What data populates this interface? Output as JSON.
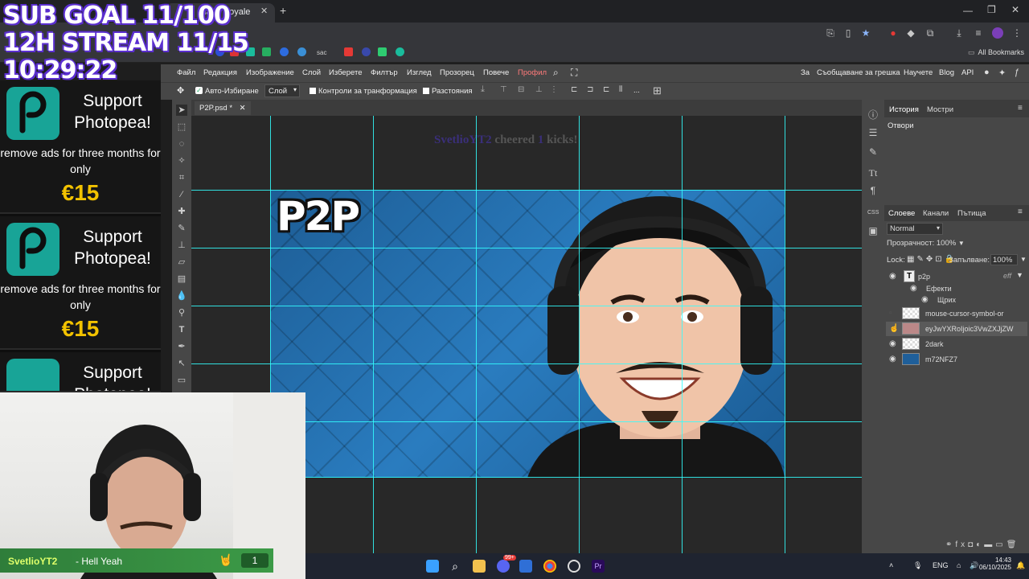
{
  "browser": {
    "tab_title": "Clash Royale",
    "bookmarks_label": "All Bookmarks",
    "bookmark_text": "sac"
  },
  "menu": {
    "items": [
      "Файл",
      "Редакция",
      "Изображение",
      "Слой",
      "Изберете",
      "Филтър",
      "Изглед",
      "Прозорец",
      "Повече",
      "Профил"
    ],
    "right_items": [
      "За",
      "Съобщаване за грешка",
      "Научете",
      "Blog",
      "API"
    ]
  },
  "options": {
    "auto_select_label": "Авто-Избиране",
    "layer_select_value": "Слой",
    "transform_controls_label": "Контроли за транформация",
    "distances_label": "Разстояния",
    "more": "..."
  },
  "document": {
    "tab_label": "P2P.psd *",
    "title_text": "P2P",
    "cheer_user": "SvetlioYT2",
    "cheer_mid": "cheered",
    "cheer_count": "1",
    "cheer_end": "kicks!"
  },
  "panels": {
    "top_tabs": [
      "История",
      "Мостри"
    ],
    "history_item": "Отвори",
    "layer_tabs": [
      "Слоеве",
      "Канали",
      "Пътища"
    ],
    "blend_mode": "Normal",
    "opacity_label": "Прозрачност:",
    "opacity_value": "100%",
    "lock_label": "Lock:",
    "fill_label": "Запълване:",
    "fill_value": "100%",
    "layers": [
      {
        "name": "p2p",
        "visible": true
      },
      {
        "name": "Ефекти",
        "visible": true
      },
      {
        "name": "Щрих",
        "visible": true
      },
      {
        "name": "mouse-cursor-symbol-or",
        "visible": false
      },
      {
        "name": "eyJwYXRoIjoic3VwZXJjZW",
        "visible": false
      },
      {
        "name": "2dark",
        "visible": true
      },
      {
        "name": "m72NFZ7",
        "visible": true
      }
    ],
    "effects_badge": "eff"
  },
  "stream": {
    "sub_goal": "SUB GOAL 11/100",
    "stream_goal": "12H STREAM 11/15",
    "timer": "10:29:22",
    "ad_head": "Support Photopea!",
    "ad_sub": "remove ads for three months for only",
    "ad_price": "€15",
    "chat_user": "SvetlioYT2",
    "chat_msg": "- Hell Yeah",
    "chat_count": "1"
  },
  "taskbar": {
    "lang": "ENG",
    "time": "14:43",
    "date": "06/10/2025",
    "badge": "99+"
  },
  "colors": {
    "accent_cyan": "#33ffff",
    "photopea_bg": "#474747",
    "stream_purple": "#5b2fd0",
    "price_yellow": "#f2c200"
  }
}
